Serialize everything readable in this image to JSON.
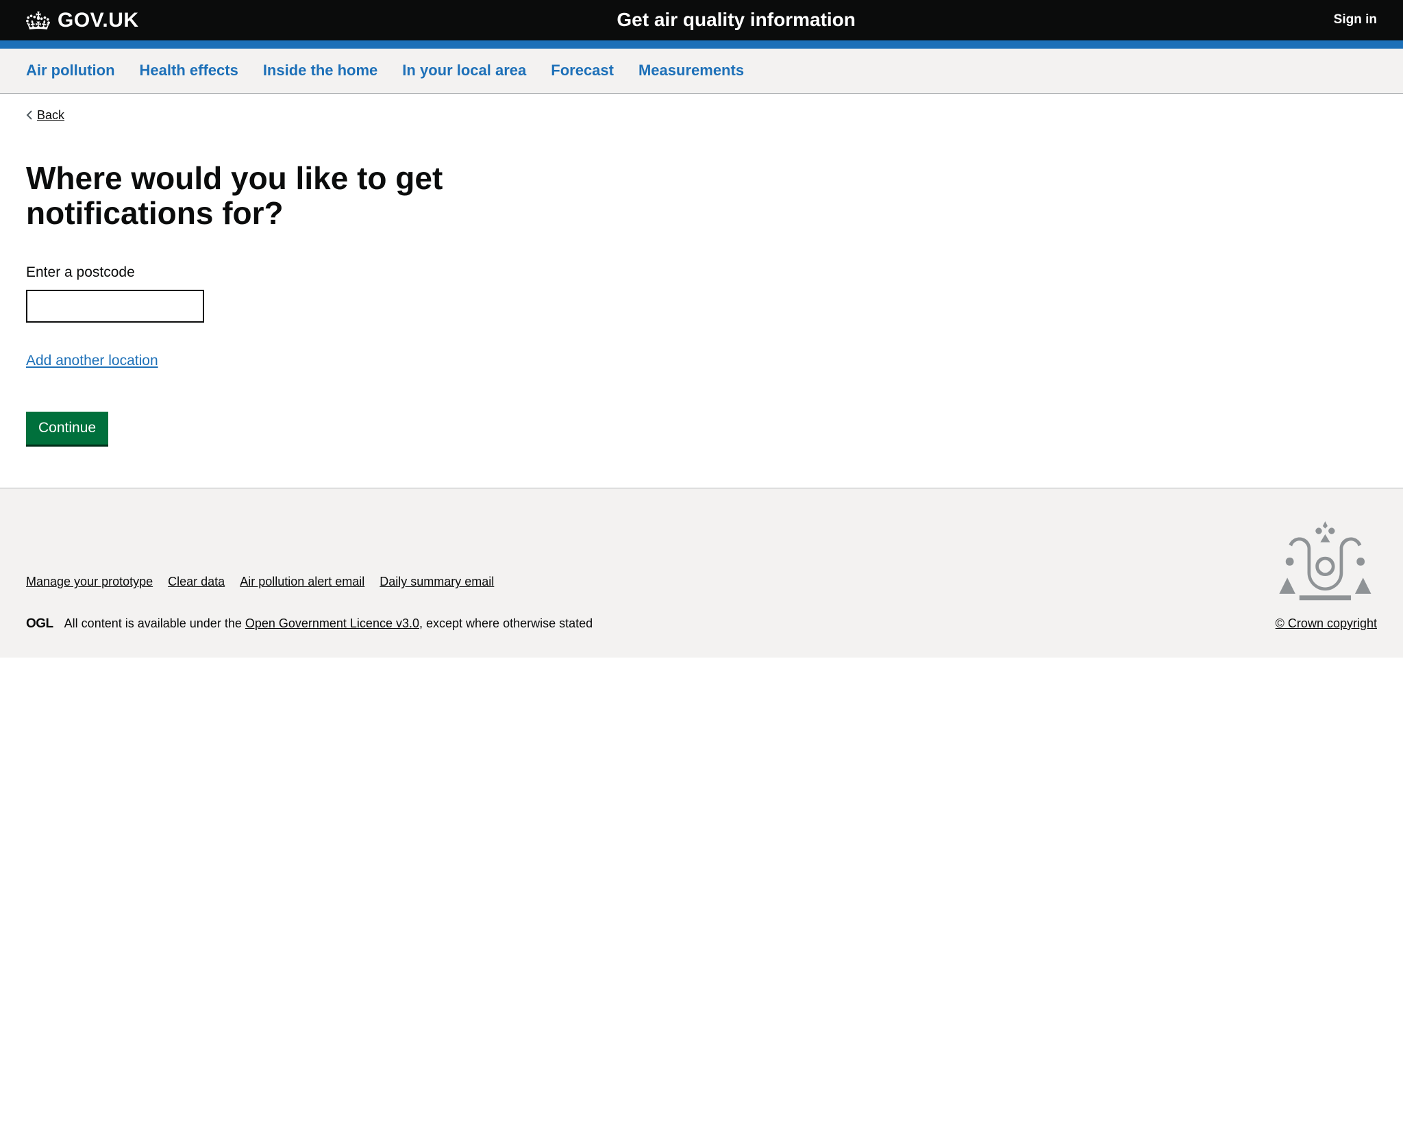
{
  "header": {
    "logo_text": "GOV.UK",
    "service_name": "Get air quality information",
    "sign_in": "Sign in"
  },
  "nav": {
    "items": [
      "Air pollution",
      "Health effects",
      "Inside the home",
      "In your local area",
      "Forecast",
      "Measurements"
    ]
  },
  "back_label": "Back",
  "page": {
    "heading": "Where would you like to get notifications for?",
    "postcode_label": "Enter a postcode",
    "postcode_value": "",
    "add_location": "Add another location",
    "continue": "Continue"
  },
  "footer": {
    "links": [
      "Manage your prototype",
      "Clear data",
      "Air pollution alert email",
      "Daily summary email"
    ],
    "licence_prefix": "All content is available under the ",
    "licence_link": "Open Government Licence v3.0",
    "licence_suffix": ", except where otherwise stated",
    "copyright": "© Crown copyright"
  }
}
